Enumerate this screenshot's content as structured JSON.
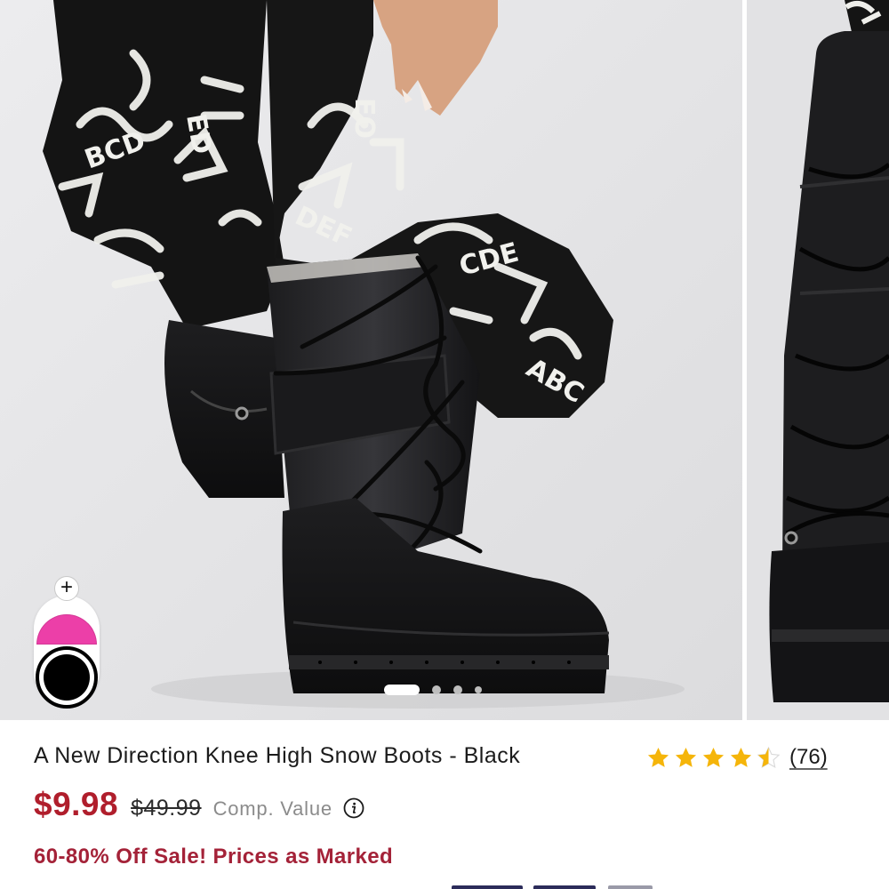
{
  "gallery": {
    "main_image": "knee-high-snow-boot-photo",
    "next_image": "boot-side-view-photo",
    "dots": {
      "count": 4,
      "active_index": 0
    },
    "swatches": {
      "add_icon": "plus-icon",
      "colors": [
        {
          "name": "pink",
          "hex": "#ec3fa8"
        },
        {
          "name": "black",
          "hex": "#000000",
          "selected": true
        }
      ]
    }
  },
  "product": {
    "title": "A New Direction Knee High Snow Boots - Black",
    "rating": {
      "value": 4.5,
      "max": 5,
      "count_label": "(76)",
      "star_color": "#f5b50a"
    },
    "price": {
      "sale": "$9.98",
      "original": "$49.99",
      "comp_label": "Comp. Value",
      "info_icon": "info-icon"
    },
    "promo": "60-80% Off Sale! Prices as Marked"
  },
  "colors": {
    "sale_red": "#b01e2c",
    "promo_red": "#a42238",
    "text": "#1b1b1b",
    "muted": "#8b8b8b"
  }
}
